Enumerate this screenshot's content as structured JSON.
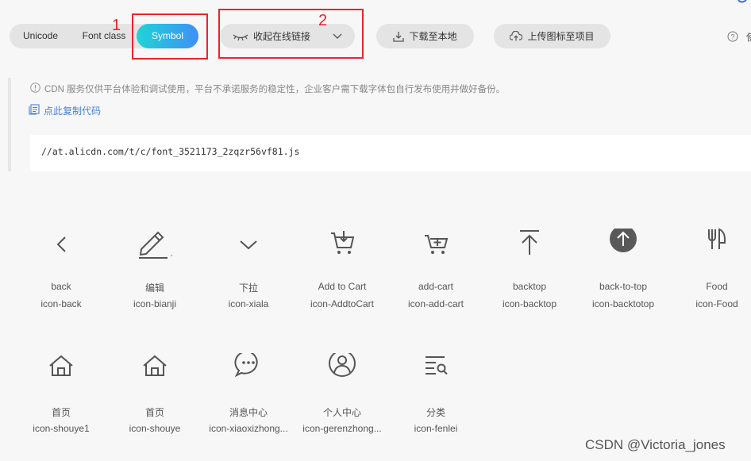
{
  "tabs": [
    "Unicode",
    "Font class",
    "Symbol"
  ],
  "active_tab": "Symbol",
  "toolbar": {
    "collapse_label": "收起在线链接",
    "download_label": "下载至本地",
    "upload_label": "上传图标至项目",
    "help_label": "使"
  },
  "annotations": {
    "box1_number": "1",
    "box2_number": "2"
  },
  "notice": "CDN 服务仅供平台体验和调试使用，平台不承诺服务的稳定性，企业客户需下载字体包自行发布使用并做好备份。",
  "copy_code_label": "点此复制代码",
  "cdn_url": "//at.alicdn.com/t/c/font_3521173_2zqzr56vf81.js",
  "icons": [
    {
      "name": "back",
      "code": "icon-back",
      "glyph": "chevron-left"
    },
    {
      "name": "编辑",
      "code": "icon-bianji",
      "glyph": "pencil"
    },
    {
      "name": "下拉",
      "code": "icon-xiala",
      "glyph": "chevron-down"
    },
    {
      "name": "Add to Cart",
      "code": "icon-AddtoCart",
      "glyph": "cart-down"
    },
    {
      "name": "add-cart",
      "code": "icon-add-cart",
      "glyph": "cart-plus"
    },
    {
      "name": "backtop",
      "code": "icon-backtop",
      "glyph": "arrow-top-bar"
    },
    {
      "name": "back-to-top",
      "code": "icon-backtotop",
      "glyph": "circle-arrow-up"
    },
    {
      "name": "Food",
      "code": "icon-Food",
      "glyph": "fork-knife"
    },
    {
      "name": "首页",
      "code": "icon-shouye1",
      "glyph": "home"
    },
    {
      "name": "首页",
      "code": "icon-shouye",
      "glyph": "home"
    },
    {
      "name": "消息中心",
      "code": "icon-xiaoxizhong...",
      "glyph": "chat-bubble"
    },
    {
      "name": "个人中心",
      "code": "icon-gerenzhong...",
      "glyph": "user-circle"
    },
    {
      "name": "分类",
      "code": "icon-fenlei",
      "glyph": "list-search"
    }
  ],
  "watermark": "CSDN @Victoria_jones",
  "colors": {
    "accent_gradient_start": "#1fd4d6",
    "accent_gradient_end": "#3f8ff7",
    "annotation_red": "#e8252b",
    "link_blue": "#4a7fd9"
  }
}
